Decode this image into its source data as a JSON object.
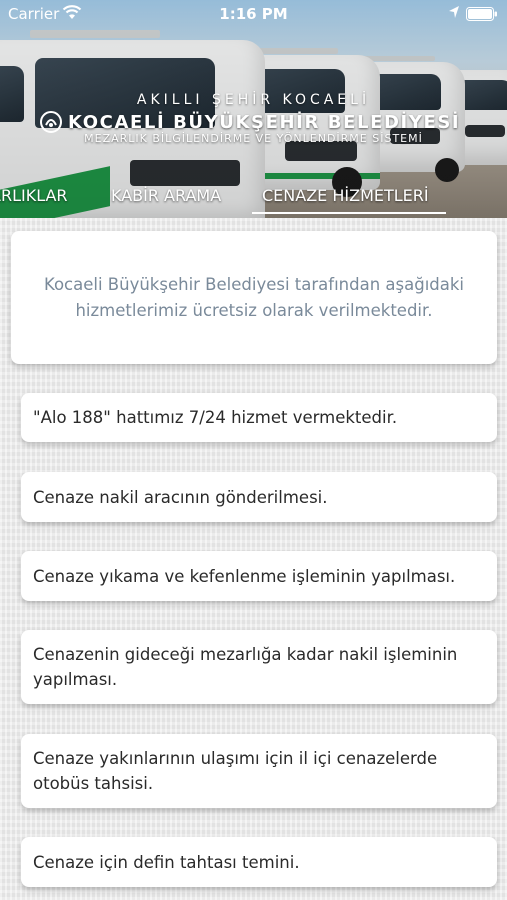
{
  "status_bar": {
    "carrier": "Carrier",
    "time": "1:16 PM"
  },
  "header": {
    "subtitle": "AKILLI ŞEHİR KOCAELİ",
    "title": "KOCAELİ BÜYÜKŞEHİR BELEDİYESİ",
    "caption": "MEZARLIK BİLGİLENDİRME VE YÖNLENDİRME SİSTEMİ"
  },
  "tabs": [
    {
      "label": "ARLIKLAR"
    },
    {
      "label": "KABİR ARAMA"
    },
    {
      "label": "CENAZE HİZMETLERİ"
    }
  ],
  "active_tab": "CENAZE HİZMETLERİ",
  "intro": {
    "text": "Kocaeli Büyükşehir Belediyesi tarafından aşağıdaki hizmetlerimiz ücretsiz olarak verilmektedir."
  },
  "services": [
    {
      "text": "\"Alo 188\" hattımız 7/24 hizmet vermektedir."
    },
    {
      "text": "Cenaze nakil aracının gönderilmesi."
    },
    {
      "text": "Cenaze yıkama ve kefenlenme işleminin yapılması."
    },
    {
      "text": "Cenazenin gideceği mezarlığa kadar nakil işleminin yapılması."
    },
    {
      "text": "Cenaze yakınlarının ulaşımı için il içi cenazelerde otobüs tahsisi."
    },
    {
      "text": "Cenaze için defin tahtası temini."
    }
  ],
  "colors": {
    "van_stripe": "#1f9a48",
    "intro_text": "#7a8a9a",
    "service_text": "#2a2a2a"
  },
  "icons": [
    "wifi-icon",
    "location-arrow-icon",
    "battery-icon",
    "municipality-logo-icon"
  ]
}
